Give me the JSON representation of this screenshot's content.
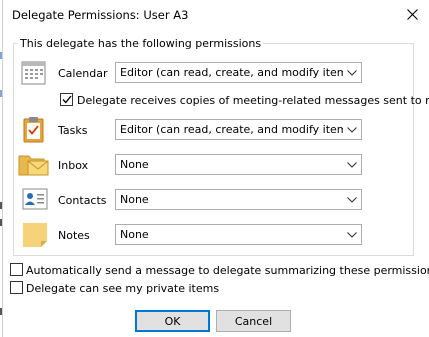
{
  "window": {
    "title": "Delegate Permissions: User A3",
    "close_icon": "close-icon"
  },
  "group": {
    "label": "This delegate has the following permissions"
  },
  "rows": [
    {
      "id": "calendar",
      "label": "Calendar",
      "value": "Editor (can read, create, and modify items)",
      "icon": "calendar-icon"
    },
    {
      "id": "tasks",
      "label": "Tasks",
      "value": "Editor (can read, create, and modify items)",
      "icon": "tasks-clipboard-icon"
    },
    {
      "id": "inbox",
      "label": "Inbox",
      "value": "None",
      "icon": "inbox-folder-icon"
    },
    {
      "id": "contacts",
      "label": "Contacts",
      "value": "None",
      "icon": "contacts-card-icon"
    },
    {
      "id": "notes",
      "label": "Notes",
      "value": "None",
      "icon": "sticky-note-icon"
    }
  ],
  "meeting_copies": {
    "label": "Delegate receives copies of meeting-related messages sent to me",
    "checked": true
  },
  "options": [
    {
      "id": "auto_send",
      "label": "Automatically send a message to delegate summarizing these permissions",
      "checked": false
    },
    {
      "id": "private_items",
      "label": "Delegate can see my private items",
      "checked": false
    }
  ],
  "buttons": {
    "ok": "OK",
    "cancel": "Cancel"
  },
  "colors": {
    "accent": "#0078d7",
    "button_face": "#e1e1e1",
    "border": "#adadad",
    "backdrop_link": "#0563c1"
  }
}
